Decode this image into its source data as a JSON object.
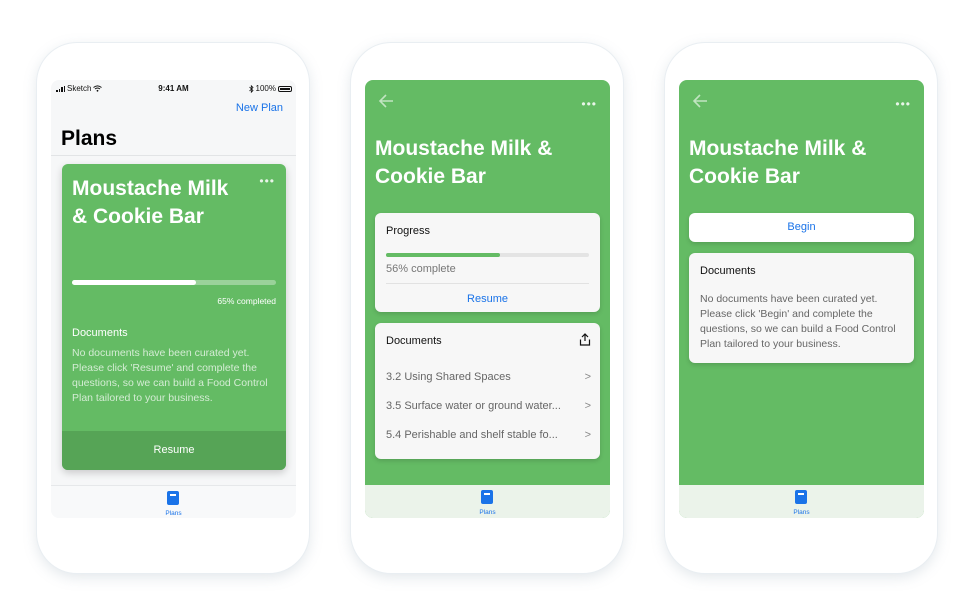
{
  "phone1": {
    "status": {
      "carrier": "Sketch",
      "time": "9:41 AM",
      "battery": "100%"
    },
    "nav_action": "New Plan",
    "title": "Plans",
    "plan_card": {
      "title": "Moustache Milk & Cookie Bar",
      "progress": 0.61,
      "progress_text": "65% completed",
      "documents_heading": "Documents",
      "documents_text": "No documents have been curated yet. Please click 'Resume' and complete the questions, so we can build a Food Control Plan tailored to your business.",
      "action": "Resume"
    },
    "tab": {
      "label": "Plans",
      "icon": "book-icon"
    }
  },
  "phone2": {
    "title": "Moustache Milk & Cookie Bar",
    "progress_card": {
      "heading": "Progress",
      "progress": 0.56,
      "progress_text": "56% complete",
      "action": "Resume"
    },
    "documents_card": {
      "heading": "Documents",
      "items": [
        "3.2 Using Shared Spaces",
        "3.5 Surface water or ground water...",
        "5.4 Perishable and shelf stable fo..."
      ]
    },
    "tab": {
      "label": "Plans",
      "icon": "book-icon"
    }
  },
  "phone3": {
    "title": "Moustache Milk & Cookie Bar",
    "begin_label": "Begin",
    "documents_card": {
      "heading": "Documents",
      "text": "No documents have been curated yet. Please click 'Begin' and complete the questions, so we can build a Food Control Plan tailored to your business."
    },
    "tab": {
      "label": "Plans",
      "icon": "book-icon"
    }
  },
  "colors": {
    "brand_green": "#64bb64",
    "link_blue": "#1a73e8"
  }
}
